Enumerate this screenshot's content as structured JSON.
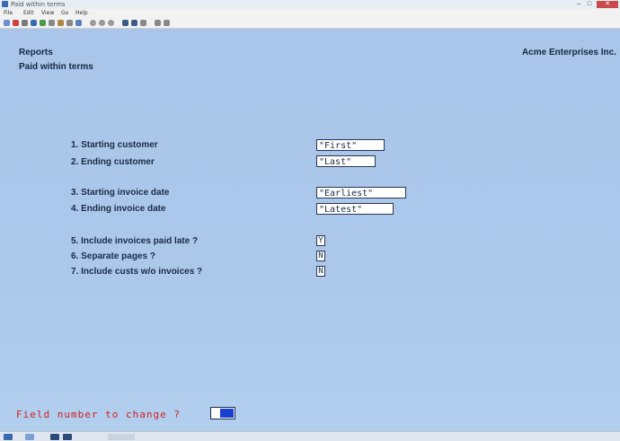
{
  "window": {
    "title": "Paid within terms"
  },
  "menu": [
    "File",
    "Edit",
    "View",
    "Go",
    "Help"
  ],
  "header": {
    "section": "Reports",
    "report_title": "Paid within terms",
    "company": "Acme Enterprises Inc."
  },
  "fields": [
    {
      "label": "1. Starting customer",
      "value": "\"First\""
    },
    {
      "label": "2. Ending customer",
      "value": "\"Last\""
    },
    {
      "label": "3. Starting invoice date",
      "value": "\"Earliest\""
    },
    {
      "label": "4. Ending invoice date",
      "value": "\"Latest\""
    },
    {
      "label": "5. Include invoices paid late ?",
      "value": "Y"
    },
    {
      "label": "6. Separate pages ?",
      "value": "N"
    },
    {
      "label": "7. Include custs w/o invoices ?",
      "value": "N"
    }
  ],
  "prompt": {
    "text": "Field number to change ?"
  },
  "colors": {
    "screen_bg": "#abc8eb",
    "prompt_red": "#d02020",
    "cursor_blue": "#1a3fd0"
  }
}
